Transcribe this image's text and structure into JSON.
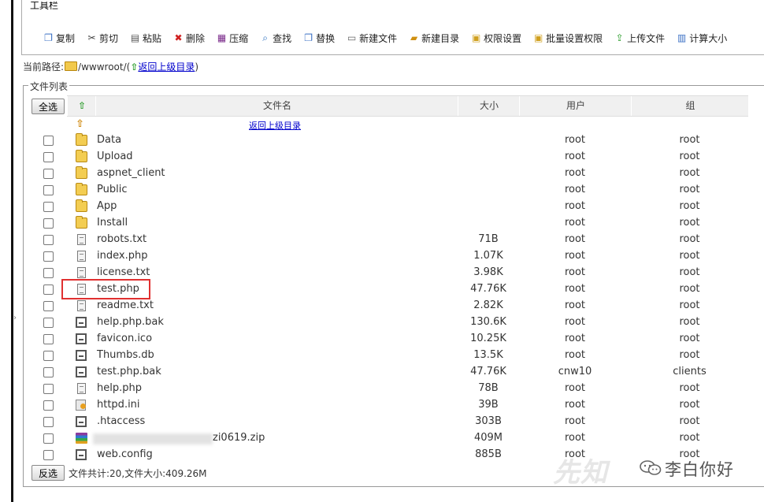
{
  "toolbar": {
    "legend": "工具栏",
    "buttons": [
      {
        "name": "copy",
        "label": "复制",
        "icon": "copy-icon",
        "color": "#3a6fc4"
      },
      {
        "name": "cut",
        "label": "剪切",
        "icon": "scissors-icon",
        "color": "#444444"
      },
      {
        "name": "paste",
        "label": "粘贴",
        "icon": "clipboard-icon",
        "color": "#555555"
      },
      {
        "name": "delete",
        "label": "删除",
        "icon": "x-icon",
        "color": "#d02020"
      },
      {
        "name": "compress",
        "label": "压缩",
        "icon": "archive-icon",
        "color": "#7a2a8a"
      },
      {
        "name": "find",
        "label": "查找",
        "icon": "magnifier-icon",
        "color": "#2a6fbf"
      },
      {
        "name": "replace",
        "label": "替换",
        "icon": "replace-icon",
        "color": "#3a6fc4"
      },
      {
        "name": "new-file",
        "label": "新建文件",
        "icon": "new-file-icon",
        "color": "#666666"
      },
      {
        "name": "new-dir",
        "label": "新建目录",
        "icon": "new-folder-icon",
        "color": "#d09010"
      },
      {
        "name": "permissions",
        "label": "权限设置",
        "icon": "lock-icon",
        "color": "#d0a020"
      },
      {
        "name": "batch-permissions",
        "label": "批量设置权限",
        "icon": "lock-icon",
        "color": "#d0a020"
      },
      {
        "name": "upload",
        "label": "上传文件",
        "icon": "upload-icon",
        "color": "#2e9e2e"
      },
      {
        "name": "calc-size",
        "label": "计算大小",
        "icon": "calculator-icon",
        "color": "#3a6fc4"
      }
    ]
  },
  "path": {
    "label": "当前路径:",
    "value": "/wwwroot/",
    "open_paren": "(",
    "back_link": "返回上级目录",
    "close_paren": ")"
  },
  "list": {
    "legend": "文件列表",
    "select_all": "全选",
    "invert": "反选",
    "columns": {
      "sort_icon": "up-arrow-icon",
      "name": "文件名",
      "size": "大小",
      "user": "用户",
      "group": "组"
    },
    "parent_link": "返回上级目录",
    "files": [
      {
        "name": "Data",
        "type": "folder",
        "size": "",
        "user": "root",
        "group": "root"
      },
      {
        "name": "Upload",
        "type": "folder",
        "size": "",
        "user": "root",
        "group": "root"
      },
      {
        "name": "aspnet_client",
        "type": "folder",
        "size": "",
        "user": "root",
        "group": "root"
      },
      {
        "name": "Public",
        "type": "folder",
        "size": "",
        "user": "root",
        "group": "root"
      },
      {
        "name": "App",
        "type": "folder",
        "size": "",
        "user": "root",
        "group": "root"
      },
      {
        "name": "Install",
        "type": "folder",
        "size": "",
        "user": "root",
        "group": "root"
      },
      {
        "name": "robots.txt",
        "type": "text",
        "size": "71B",
        "user": "root",
        "group": "root"
      },
      {
        "name": "index.php",
        "type": "text",
        "size": "1.07K",
        "user": "root",
        "group": "root"
      },
      {
        "name": "license.txt",
        "type": "text",
        "size": "3.98K",
        "user": "root",
        "group": "root"
      },
      {
        "name": "test.php",
        "type": "text",
        "size": "47.76K",
        "user": "root",
        "group": "root"
      },
      {
        "name": "readme.txt",
        "type": "text",
        "size": "2.82K",
        "user": "root",
        "group": "root"
      },
      {
        "name": "help.php.bak",
        "type": "bin",
        "size": "130.6K",
        "user": "root",
        "group": "root"
      },
      {
        "name": "favicon.ico",
        "type": "bin",
        "size": "10.25K",
        "user": "root",
        "group": "root"
      },
      {
        "name": "Thumbs.db",
        "type": "bin",
        "size": "13.5K",
        "user": "root",
        "group": "root"
      },
      {
        "name": "test.php.bak",
        "type": "bin",
        "size": "47.76K",
        "user": "cnw10",
        "group": "clients"
      },
      {
        "name": "help.php",
        "type": "text",
        "size": "78B",
        "user": "root",
        "group": "root"
      },
      {
        "name": "httpd.ini",
        "type": "ini",
        "size": "39B",
        "user": "root",
        "group": "root"
      },
      {
        "name": ".htaccess",
        "type": "bin",
        "size": "303B",
        "user": "root",
        "group": "root"
      },
      {
        "name": "zi0619.zip",
        "type": "zip",
        "size": "409M",
        "user": "root",
        "group": "root",
        "blurred": true
      },
      {
        "name": "web.config",
        "type": "bin",
        "size": "885B",
        "user": "root",
        "group": "root"
      }
    ],
    "summary": "文件共计:20,文件大小:409.26M",
    "highlight_file": "test.php",
    "highlight_color": "#e03030"
  },
  "watermark": {
    "logo_text": "先知",
    "account": "李白你好"
  }
}
